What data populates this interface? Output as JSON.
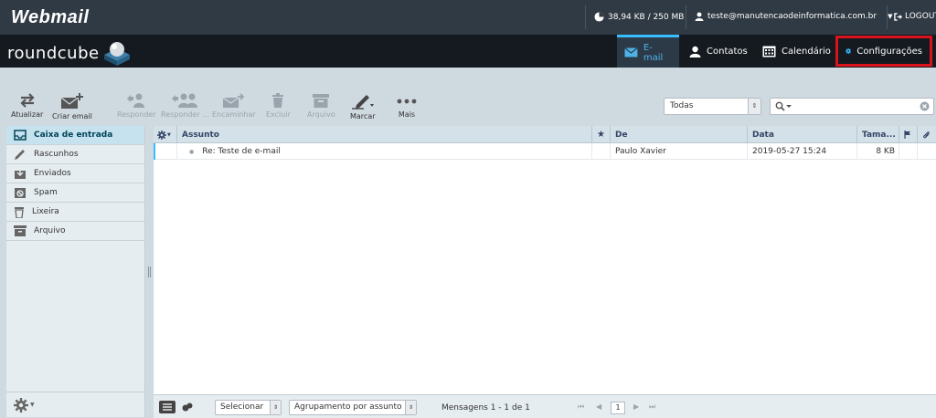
{
  "topbar": {
    "logo": "Webmail",
    "quota": "38,94 KB / 250 MB",
    "user": "teste@manutencaodeinformatica.com.br",
    "logout": "LOGOUT"
  },
  "header": {
    "logo": "roundcube",
    "tabs": {
      "email": "E-mail",
      "contacts": "Contatos",
      "calendar": "Calendário",
      "settings": "Configurações"
    }
  },
  "toolbar": {
    "refresh": "Atualizar",
    "compose": "Criar email",
    "reply": "Responder",
    "reply_all": "Responder ...",
    "forward": "Encaminhar",
    "delete": "Excluir",
    "archive": "Arquivo",
    "mark": "Marcar",
    "more": "Mais",
    "filter": "Todas"
  },
  "folders": [
    {
      "label": "Caixa de entrada",
      "icon": "inbox-icon"
    },
    {
      "label": "Rascunhos",
      "icon": "pencil-icon"
    },
    {
      "label": "Enviados",
      "icon": "sent-icon"
    },
    {
      "label": "Spam",
      "icon": "spam-icon"
    },
    {
      "label": "Lixeira",
      "icon": "trash-icon"
    },
    {
      "label": "Arquivo",
      "icon": "archive-icon"
    }
  ],
  "list": {
    "headers": {
      "subject": "Assunto",
      "from": "De",
      "date": "Data",
      "size": "Tama..."
    },
    "rows": [
      {
        "subject": "Re: Teste de e-mail",
        "from": "Paulo Xavier",
        "date": "2019-05-27 15:24",
        "size": "8 KB"
      }
    ]
  },
  "footer": {
    "select": "Selecionar",
    "threads": "Agrupamento por assunto",
    "count": "Mensagens 1 - 1 de 1",
    "page": "1"
  },
  "colors": {
    "accent": "#37beff",
    "highlight_border": "#d9131c"
  }
}
